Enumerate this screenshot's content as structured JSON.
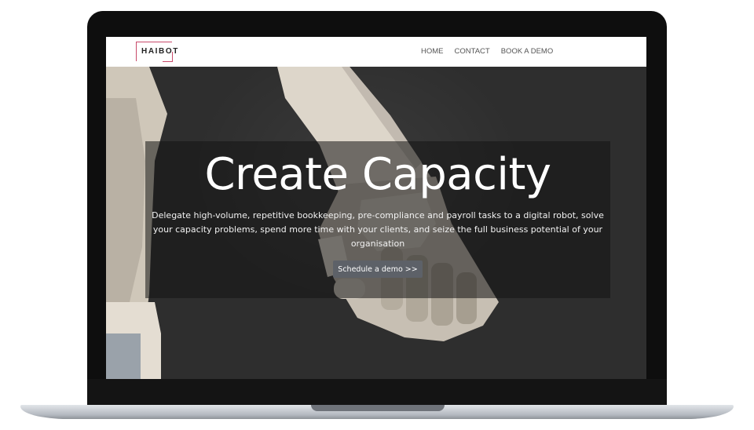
{
  "site": {
    "logo": "HAIBOT",
    "nav": {
      "home": "HOME",
      "contact": "CONTACT",
      "book_demo": "BOOK A DEMO"
    }
  },
  "hero": {
    "title": "Create Capacity",
    "description": "Delegate high-volume, repetitive bookkeeping, pre-compliance and payroll tasks to a digital robot, solve your capacity problems, spend more time with your clients, and seize the full business potential of your organisation",
    "cta_label": "Schedule a demo >>"
  },
  "colors": {
    "logo_accent": "#c84a6a",
    "nav_text": "#555555",
    "hero_background": "#2e2e2e",
    "cta_background": "#5d6168"
  },
  "icons": {
    "hero_image": "robot-hand-image"
  }
}
